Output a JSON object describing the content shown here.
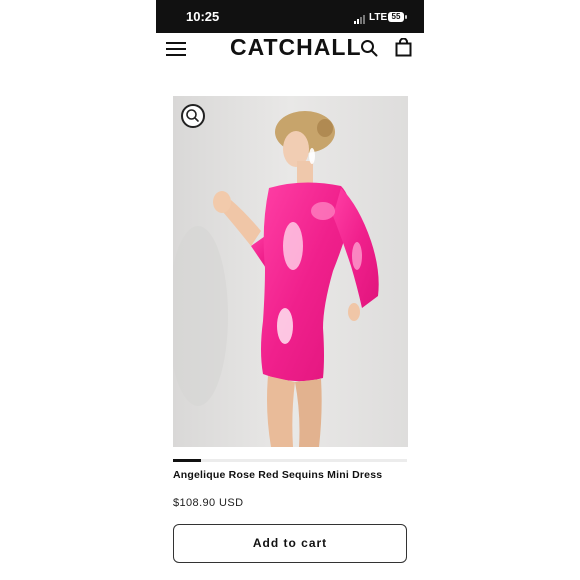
{
  "status_bar": {
    "time": "10:25",
    "network": "LTE",
    "battery": "55"
  },
  "header": {
    "logo": "CATCHALL",
    "menu_icon": "hamburger-menu-icon",
    "search_icon": "search-icon",
    "cart_icon": "shopping-bag-icon"
  },
  "product": {
    "title": "Angelique Rose Red Sequins Mini Dress",
    "price": "$108.90 USD",
    "image_progress": 0.12,
    "zoom_icon": "zoom-icon"
  },
  "actions": {
    "add_to_cart": "Add to cart"
  },
  "colors": {
    "dress": "#f0208c",
    "button_border": "#333333",
    "background": "#e3e2e1"
  }
}
